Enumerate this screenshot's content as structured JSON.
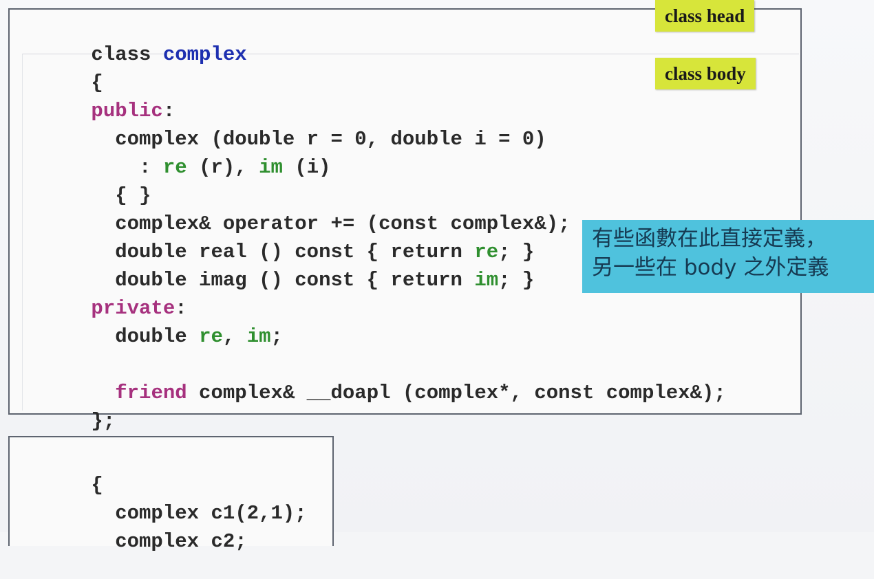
{
  "labels": {
    "class_head": "class head",
    "class_body": "class body"
  },
  "note": {
    "line1": "有些函數在此直接定義，",
    "line2": "另一些在 body 之外定義"
  },
  "code_main": {
    "l1": {
      "t1": "class ",
      "t2": "complex"
    },
    "l2": {
      "t1": "{"
    },
    "l3": {
      "t1": "public",
      "t2": ":"
    },
    "l4": {
      "t1": "  complex (double r = 0, double i = 0)"
    },
    "l5": {
      "t1": "    : ",
      "t2": "re",
      "t3": " (r), ",
      "t4": "im",
      "t5": " (i)"
    },
    "l6": {
      "t1": "  { }"
    },
    "l7": {
      "t1": "  complex& operator += (const complex&);"
    },
    "l8": {
      "t1": "  double real () const { return ",
      "t2": "re",
      "t3": "; }"
    },
    "l9": {
      "t1": "  double imag () const { return ",
      "t2": "im",
      "t3": "; }"
    },
    "l10": {
      "t1": "private",
      "t2": ":"
    },
    "l11": {
      "t1": "  double ",
      "t2": "re",
      "t3": ", ",
      "t4": "im",
      "t5": ";"
    },
    "l12": {
      "t1": "  ",
      "t2": "friend",
      "t3": " complex& __doapl (complex*, const complex&);"
    },
    "l13": {
      "t1": "};"
    }
  },
  "code_usage": {
    "l1": {
      "t1": "{"
    },
    "l2": {
      "t1": "  complex c1(2,1);"
    },
    "l3": {
      "t1": "  complex c2;"
    }
  },
  "colors": {
    "keyword_blue": "#1d2fb0",
    "keyword_purple": "#a6317e",
    "member_green": "#2f8f2f",
    "label_yellow": "#d7e53a",
    "note_cyan": "#4fc2dd"
  }
}
